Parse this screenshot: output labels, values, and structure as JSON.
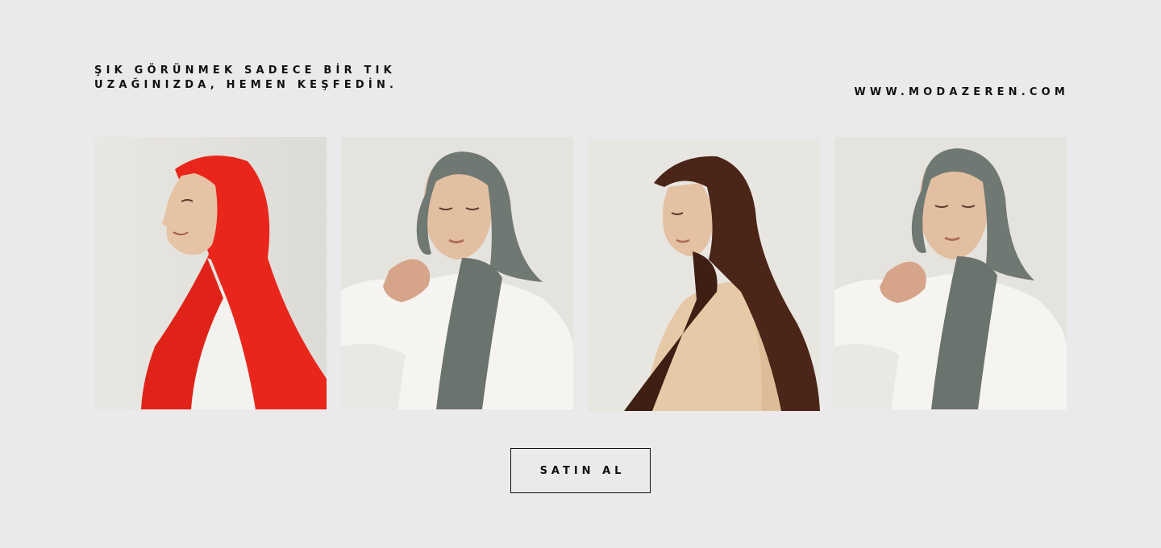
{
  "promo": {
    "tagline_line1": "ŞIK GÖRÜNMEK SADECE BİR TIK",
    "tagline_line2": "UZAĞINIZDA, HEMEN KEŞFEDİN.",
    "website": "WWW.MODAZEREN.COM",
    "cta_label": "SATIN AL"
  },
  "gallery": {
    "photos": [
      {
        "subject": "model-red-hijab",
        "scarf_color": "#e8261c",
        "top_color": "#f4f2ef"
      },
      {
        "subject": "model-grey-hijab",
        "scarf_color": "#6f7872",
        "top_color": "#f5f4f1"
      },
      {
        "subject": "model-brown-hijab",
        "scarf_color": "#4a2518",
        "top_color": "#e6c9a6"
      },
      {
        "subject": "model-grey-hijab",
        "scarf_color": "#6f7872",
        "top_color": "#f5f4f1"
      }
    ]
  },
  "colors": {
    "background": "#ebe9ea",
    "text": "#111111"
  }
}
